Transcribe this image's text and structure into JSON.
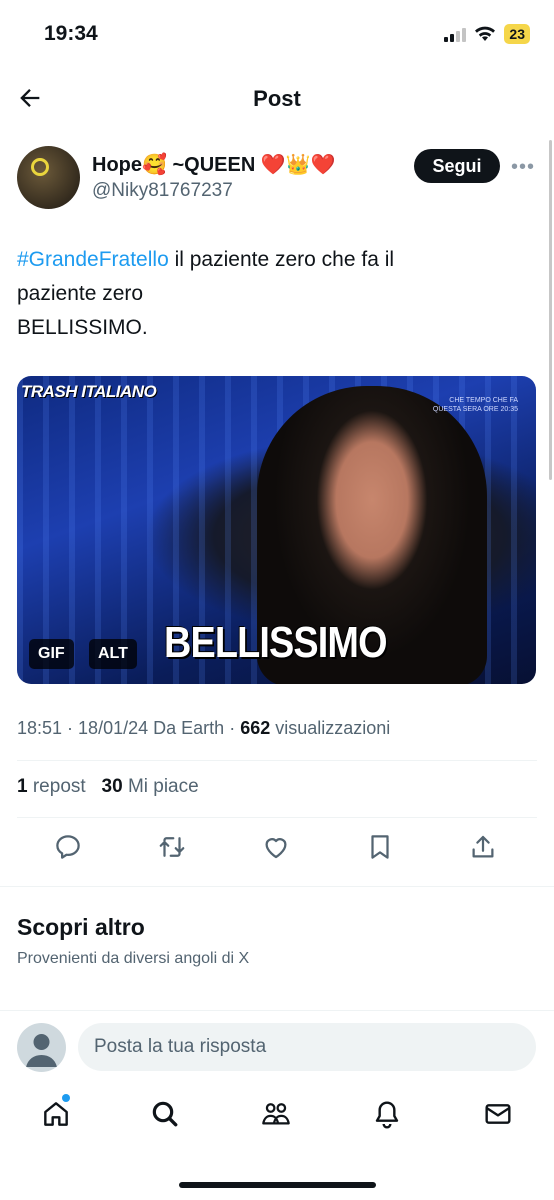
{
  "status_bar": {
    "time": "19:34",
    "battery": "23"
  },
  "header": {
    "title": "Post"
  },
  "author": {
    "name": "Hope🥰 ~QUEEN ❤️👑❤️",
    "handle": "@Niky81767237",
    "follow_label": "Segui"
  },
  "tweet": {
    "hashtag": "#GrandeFratello",
    "text_line1": " il paziente zero che fa il",
    "text_line2": "paziente zero",
    "text_line3": "BELLISSIMO."
  },
  "media": {
    "brand": "TRASH ITALIANO",
    "overlay_top": "CHE TEMPO CHE FA\nQUESTA SERA ORE 20:35",
    "caption": "BELLISSIMO",
    "badge_gif": "GIF",
    "badge_alt": "ALT"
  },
  "meta": {
    "time": "18:51",
    "date": "18/01/24",
    "source": "Da Earth",
    "views_count": "662",
    "views_label": "visualizzazioni"
  },
  "stats": {
    "reposts_count": "1",
    "reposts_label": "repost",
    "likes_count": "30",
    "likes_label": "Mi piace"
  },
  "discover": {
    "title": "Scopri altro",
    "subtitle": "Provenienti da diversi angoli di X"
  },
  "reply": {
    "placeholder": "Posta la tua risposta"
  },
  "colors": {
    "accent": "#1d9bf0",
    "text": "#0f1419",
    "muted": "#536471"
  },
  "icons": [
    "back-arrow-icon",
    "more-icon",
    "reply-icon",
    "repost-icon",
    "like-icon",
    "bookmark-icon",
    "share-icon",
    "home-icon",
    "search-icon",
    "communities-icon",
    "notifications-icon",
    "messages-icon"
  ]
}
